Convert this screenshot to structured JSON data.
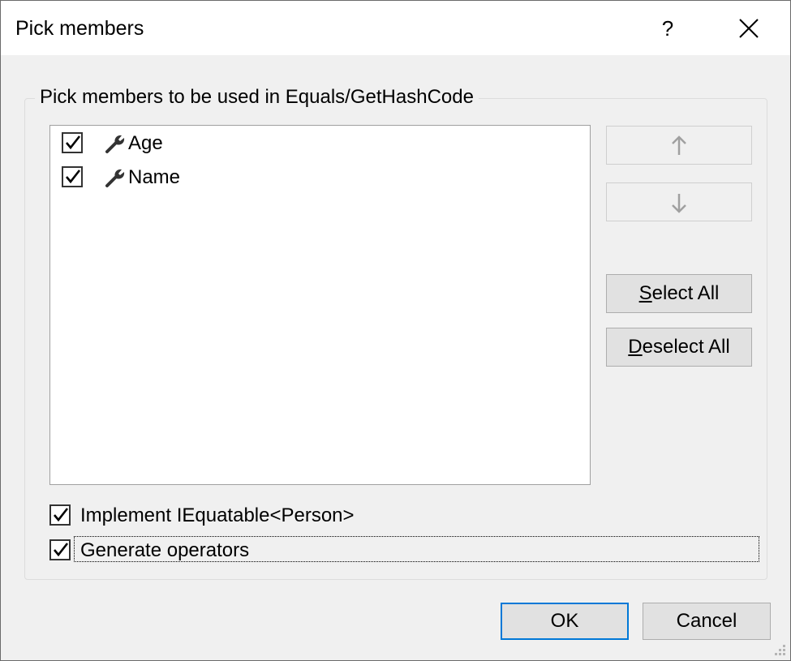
{
  "dialog": {
    "title": "Pick members",
    "help_label": "?",
    "close_label": "close"
  },
  "group": {
    "legend": "Pick members to be used in Equals/GetHashCode"
  },
  "members": [
    {
      "label": "Age",
      "checked": true,
      "icon": "wrench-icon"
    },
    {
      "label": "Name",
      "checked": true,
      "icon": "wrench-icon"
    }
  ],
  "side_buttons": {
    "move_up_icon": "arrow-up-icon",
    "move_down_icon": "arrow-down-icon",
    "select_all_mnemonic": "S",
    "select_all_rest": "elect All",
    "deselect_all_mnemonic": "D",
    "deselect_all_rest": "eselect All"
  },
  "options": [
    {
      "label": "Implement IEquatable<Person>",
      "checked": true
    },
    {
      "label": "Generate operators",
      "checked": true,
      "focused": true
    }
  ],
  "footer": {
    "ok_label": "OK",
    "cancel_label": "Cancel"
  },
  "colors": {
    "dialog_bg": "#f0f0f0",
    "titlebar_bg": "#ffffff",
    "default_button_border": "#0078d7",
    "disabled_arrow": "#a0a0a0"
  }
}
